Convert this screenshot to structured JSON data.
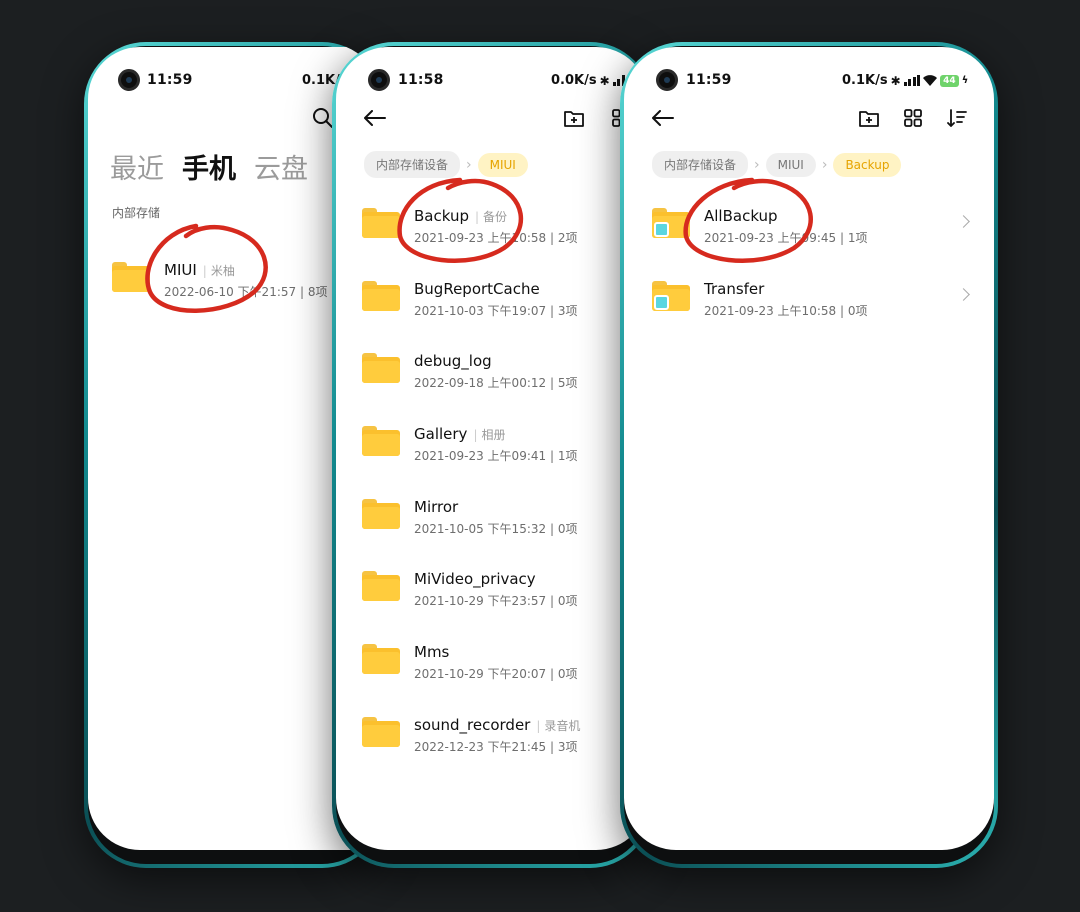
{
  "phone1": {
    "status": {
      "time": "11:59",
      "speed": "0.1K/"
    },
    "tabs": [
      "最近",
      "手机",
      "云盘"
    ],
    "section_label": "内部存储",
    "items": [
      {
        "name": "MIUI",
        "alias": "米柚",
        "date": "2022-06-10 下午21:57",
        "count": "8项"
      }
    ]
  },
  "phone2": {
    "status": {
      "time": "11:58",
      "speed": "0.0K/s"
    },
    "breadcrumbs": [
      "内部存储设备",
      "MIUI"
    ],
    "items": [
      {
        "name": "Backup",
        "alias": "备份",
        "date": "2021-09-23 上午10:58",
        "count": "2项"
      },
      {
        "name": "BugReportCache",
        "alias": "",
        "date": "2021-10-03 下午19:07",
        "count": "3项"
      },
      {
        "name": "debug_log",
        "alias": "",
        "date": "2022-09-18 上午00:12",
        "count": "5项"
      },
      {
        "name": "Gallery",
        "alias": "相册",
        "date": "2021-09-23 上午09:41",
        "count": "1项"
      },
      {
        "name": "Mirror",
        "alias": "",
        "date": "2021-10-05 下午15:32",
        "count": "0项"
      },
      {
        "name": "MiVideo_privacy",
        "alias": "",
        "date": "2021-10-29 下午23:57",
        "count": "0项"
      },
      {
        "name": "Mms",
        "alias": "",
        "date": "2021-10-29 下午20:07",
        "count": "0项"
      },
      {
        "name": "sound_recorder",
        "alias": "录音机",
        "date": "2022-12-23 下午21:45",
        "count": "3项"
      }
    ]
  },
  "phone3": {
    "status": {
      "time": "11:59",
      "speed": "0.1K/s",
      "battery": "44"
    },
    "breadcrumbs": [
      "内部存储设备",
      "MIUI",
      "Backup"
    ],
    "items": [
      {
        "name": "AllBackup",
        "alias": "",
        "date": "2021-09-23 上午09:45",
        "count": "1项"
      },
      {
        "name": "Transfer",
        "alias": "",
        "date": "2021-09-23 上午10:58",
        "count": "0项"
      }
    ]
  },
  "colors": {
    "accent_folder": "#fbc02d",
    "highlight_crumb": "#e6a400",
    "annotation": "#d62a1e",
    "frame": "#138a8f"
  }
}
